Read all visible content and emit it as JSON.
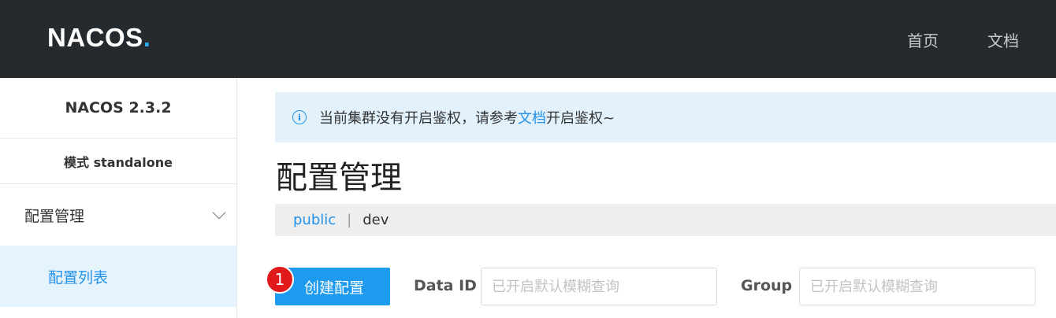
{
  "header": {
    "logo_text": "NACOS",
    "logo_dot": ".",
    "nav": [
      "首页",
      "文档"
    ]
  },
  "sidebar": {
    "version": "NACOS 2.3.2",
    "mode": "模式 standalone",
    "menu_label": "配置管理",
    "submenu_label": "配置列表"
  },
  "notice": {
    "text_before": "当前集群没有开启鉴权，请参考",
    "link_text": "文档",
    "text_after": "开启鉴权~"
  },
  "main": {
    "title": "配置管理",
    "namespaces": {
      "public": "public",
      "separator": "|",
      "dev": "dev"
    },
    "create_button": "创建配置",
    "badge": "1",
    "data_id_label": "Data ID",
    "data_id_placeholder": "已开启默认模糊查询",
    "group_label": "Group",
    "group_placeholder": "已开启默认模糊查询"
  },
  "colors": {
    "topbar_bg": "#252a2f",
    "accent": "#2392ea",
    "button_bg": "#1e9aef",
    "badge_bg": "#e01a1a",
    "notice_bg": "#e2f1fc",
    "active_menu_bg": "#e5f3ff"
  }
}
